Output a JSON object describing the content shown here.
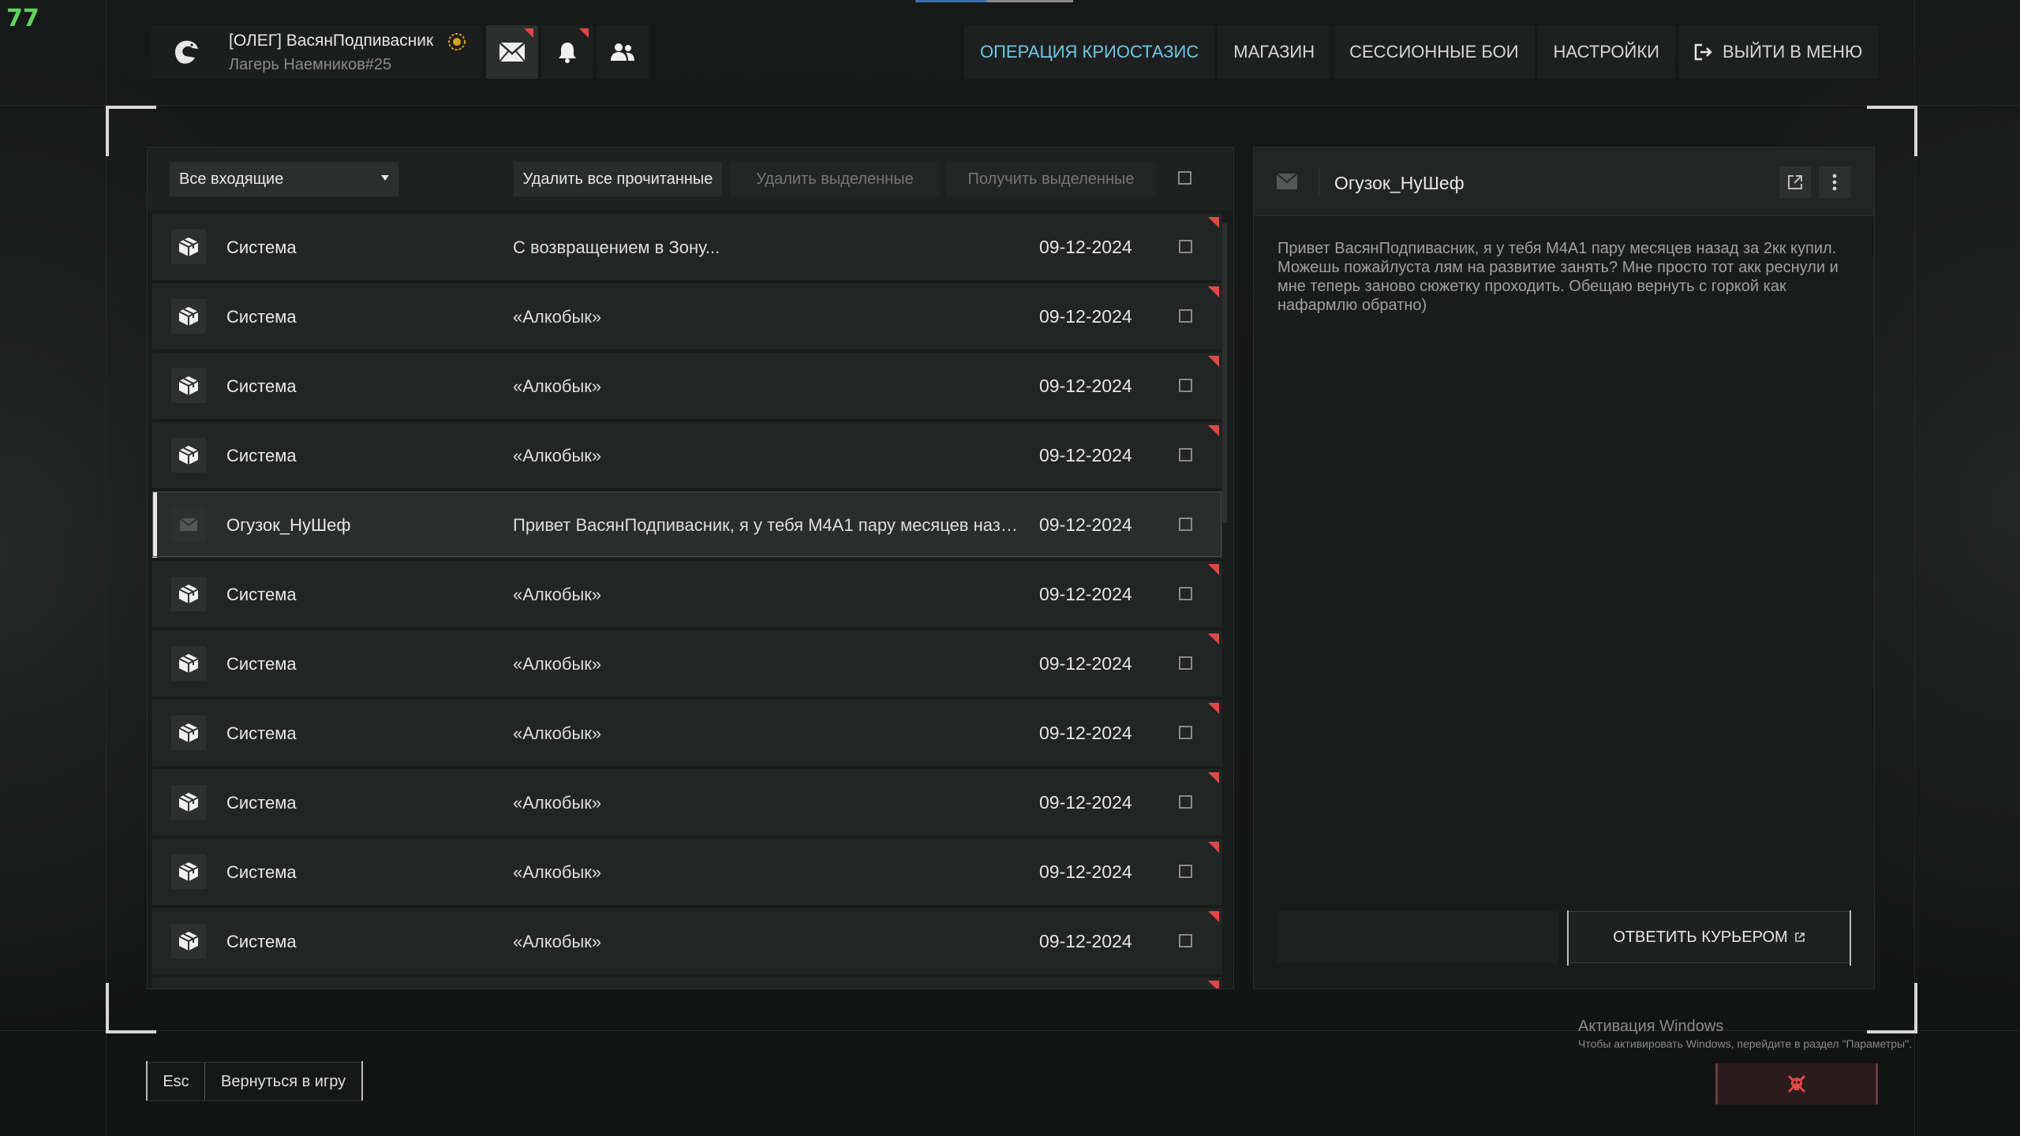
{
  "hud": {
    "fps": "77"
  },
  "profile": {
    "name": "[ОЛЕГ] ВасянПодпивасник",
    "subtitle": "Лагерь Наемников#25"
  },
  "nav": {
    "items": [
      {
        "label": "ОПЕРАЦИЯ КРИОСТАЗИС",
        "active": true
      },
      {
        "label": "МАГАЗИН"
      },
      {
        "label": "СЕССИОННЫЕ БОИ"
      },
      {
        "label": "НАСТРОЙКИ"
      },
      {
        "label": "ВЫЙТИ В МЕНЮ",
        "icon": "exit-icon"
      }
    ]
  },
  "toolbar": {
    "filter_value": "Все входящие",
    "delete_read": "Удалить все прочитанные",
    "delete_selected": "Удалить выделенные",
    "get_selected": "Получить выделенные"
  },
  "messages": [
    {
      "sender": "Система",
      "subject": "С возвращением в Зону...",
      "date": "09-12-2024",
      "unread": true,
      "icon": "box-icon"
    },
    {
      "sender": "Система",
      "subject": "«Алкобык»",
      "date": "09-12-2024",
      "unread": true,
      "icon": "box-icon"
    },
    {
      "sender": "Система",
      "subject": "«Алкобык»",
      "date": "09-12-2024",
      "unread": true,
      "icon": "box-icon"
    },
    {
      "sender": "Система",
      "subject": "«Алкобык»",
      "date": "09-12-2024",
      "unread": true,
      "icon": "box-icon"
    },
    {
      "sender": "Огузок_НуШеф",
      "subject": "Привет ВасянПодпивасник, я у тебя М4А1 пару месяцев назад..",
      "date": "09-12-2024",
      "unread": false,
      "selected": true,
      "icon": "mail-icon"
    },
    {
      "sender": "Система",
      "subject": "«Алкобык»",
      "date": "09-12-2024",
      "unread": true,
      "icon": "box-icon"
    },
    {
      "sender": "Система",
      "subject": "«Алкобык»",
      "date": "09-12-2024",
      "unread": true,
      "icon": "box-icon"
    },
    {
      "sender": "Система",
      "subject": "«Алкобык»",
      "date": "09-12-2024",
      "unread": true,
      "icon": "box-icon"
    },
    {
      "sender": "Система",
      "subject": "«Алкобык»",
      "date": "09-12-2024",
      "unread": true,
      "icon": "box-icon"
    },
    {
      "sender": "Система",
      "subject": "«Алкобык»",
      "date": "09-12-2024",
      "unread": true,
      "icon": "box-icon"
    },
    {
      "sender": "Система",
      "subject": "«Алкобык»",
      "date": "09-12-2024",
      "unread": true,
      "icon": "box-icon"
    }
  ],
  "reader": {
    "title": "Огузок_НуШеф",
    "body": "Привет ВасянПодпивасник, я у тебя М4А1 пару месяцев назад за 2кк купил. Можешь пожайлуста лям на развитие занять? Мне просто тот акк реснули и мне теперь заново сюжетку проходить. Обещаю вернуть с горкой как нафармлю обратно)",
    "reply_label": "ОТВЕТИТЬ КУРЬЕРОМ"
  },
  "bottom": {
    "esc_key": "Esc",
    "esc_label": "Вернуться в игру"
  },
  "windows_activation": {
    "title": "Активация Windows",
    "subtitle": "Чтобы активировать Windows, перейдите в раздел \"Параметры\"."
  },
  "colors": {
    "accent_nav": "#6cc9e6",
    "unread_flag": "#e04848",
    "background": "#121313"
  }
}
